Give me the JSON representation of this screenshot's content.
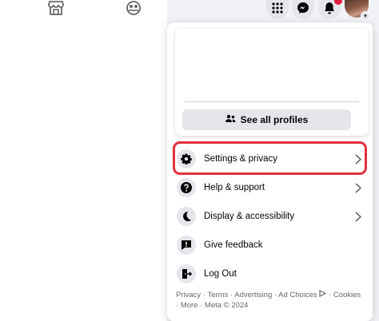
{
  "topbar": {
    "left_icons": [
      "marketplace-icon",
      "groups-icon"
    ],
    "right_icons": [
      "menu-grid-icon",
      "messenger-icon",
      "bell-icon"
    ],
    "notification_badge_color": "#e41e3f"
  },
  "dropdown": {
    "see_all_profiles_label": "See all profiles",
    "items": [
      {
        "label": "Settings & privacy",
        "icon": "gear-icon",
        "has_chevron": true,
        "highlighted": true
      },
      {
        "label": "Help & support",
        "icon": "help-icon",
        "has_chevron": true
      },
      {
        "label": "Display & accessibility",
        "icon": "moon-icon",
        "has_chevron": true
      },
      {
        "label": "Give feedback",
        "icon": "feedback-icon",
        "has_chevron": false
      },
      {
        "label": "Log Out",
        "icon": "logout-icon",
        "has_chevron": false
      }
    ],
    "highlight_color": "#e2313b",
    "footer": {
      "privacy": "Privacy",
      "terms": "Terms",
      "advertising": "Advertising",
      "ad_choices": "Ad Choices",
      "cookies": "Cookies",
      "more": "More",
      "copyright": "Meta © 2024",
      "separator": " · "
    }
  }
}
